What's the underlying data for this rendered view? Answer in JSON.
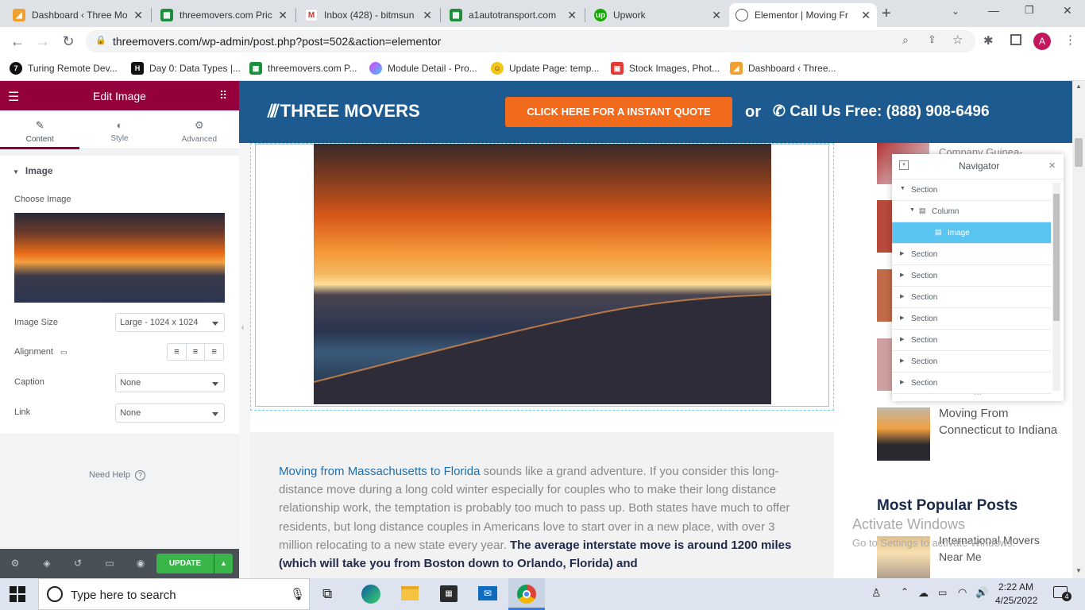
{
  "browser": {
    "tabs": [
      {
        "title": "Dashboard ‹ Three Mo",
        "icon": "three-movers-icon"
      },
      {
        "title": "threemovers.com Pric",
        "icon": "sheets-icon"
      },
      {
        "title": "Inbox (428) - bitmsun",
        "icon": "gmail-icon"
      },
      {
        "title": "a1autotransport.com",
        "icon": "sheets-icon"
      },
      {
        "title": "Upwork",
        "icon": "upwork-icon"
      },
      {
        "title": "Elementor | Moving Fr",
        "icon": "globe-icon"
      }
    ],
    "url": "threemovers.com/wp-admin/post.php?post=502&action=elementor",
    "profile_initial": "A",
    "bookmarks": [
      "Turing Remote Dev...",
      "Day 0: Data Types |...",
      "threemovers.com P...",
      "Module Detail - Pro...",
      "Update Page: temp...",
      "Stock Images, Phot...",
      "Dashboard ‹ Three..."
    ]
  },
  "editor": {
    "title": "Edit Image",
    "tabs": [
      "Content",
      "Style",
      "Advanced"
    ],
    "section": "Image",
    "choose_image_label": "Choose Image",
    "image_size_label": "Image Size",
    "image_size_value": "Large - 1024 x 1024",
    "alignment_label": "Alignment",
    "caption_label": "Caption",
    "caption_value": "None",
    "link_label": "Link",
    "link_value": "None",
    "need_help": "Need Help",
    "update_button": "UPDATE"
  },
  "site": {
    "logo": "THREE MOVERS",
    "cta": "CLICK HERE FOR A INSTANT QUOTE",
    "or": "or",
    "phone": "Call Us Free: (888) 908-6496",
    "article_link": "Moving from Massachusetts to Florida",
    "article_text": " sounds like a grand adventure. If you consider this long-distance move during a long cold winter especially for couples who to make their long distance relationship work, the temptation is probably too much to pass up. Both states have much to offer residents, but long distance couples in Americans love to start over in a new place, with over 3 million relocating to a new state every year. ",
    "article_bold": "The average interstate move is around 1200 miles (which will take you from Boston down to Orlando, Florida) and",
    "sidebar_top_title": "Company Guinea-",
    "sidebar_post": "Moving From Connecticut to Indiana",
    "popular_heading": "Most Popular Posts",
    "popular_post": "International Movers Near Me"
  },
  "navigator": {
    "title": "Navigator",
    "items": [
      {
        "label": "Section",
        "level": 0,
        "expanded": true
      },
      {
        "label": "Column",
        "level": 1,
        "expanded": true
      },
      {
        "label": "Image",
        "level": 2,
        "selected": true
      },
      {
        "label": "Section",
        "level": 0
      },
      {
        "label": "Section",
        "level": 0
      },
      {
        "label": "Section",
        "level": 0
      },
      {
        "label": "Section",
        "level": 0
      },
      {
        "label": "Section",
        "level": 0
      },
      {
        "label": "Section",
        "level": 0
      },
      {
        "label": "Section",
        "level": 0
      }
    ]
  },
  "watermark": {
    "line1": "Activate Windows",
    "line2": "Go to Settings to activate Windows."
  },
  "taskbar": {
    "search_placeholder": "Type here to search",
    "time": "2:22 AM",
    "date": "4/25/2022",
    "notification_count": "4"
  },
  "colors": {
    "elementor": "#93003c",
    "site_blue": "#1d5a8f",
    "cta_orange": "#f26b1d",
    "update_green": "#39b54a",
    "nav_selected": "#5bc5f2"
  }
}
